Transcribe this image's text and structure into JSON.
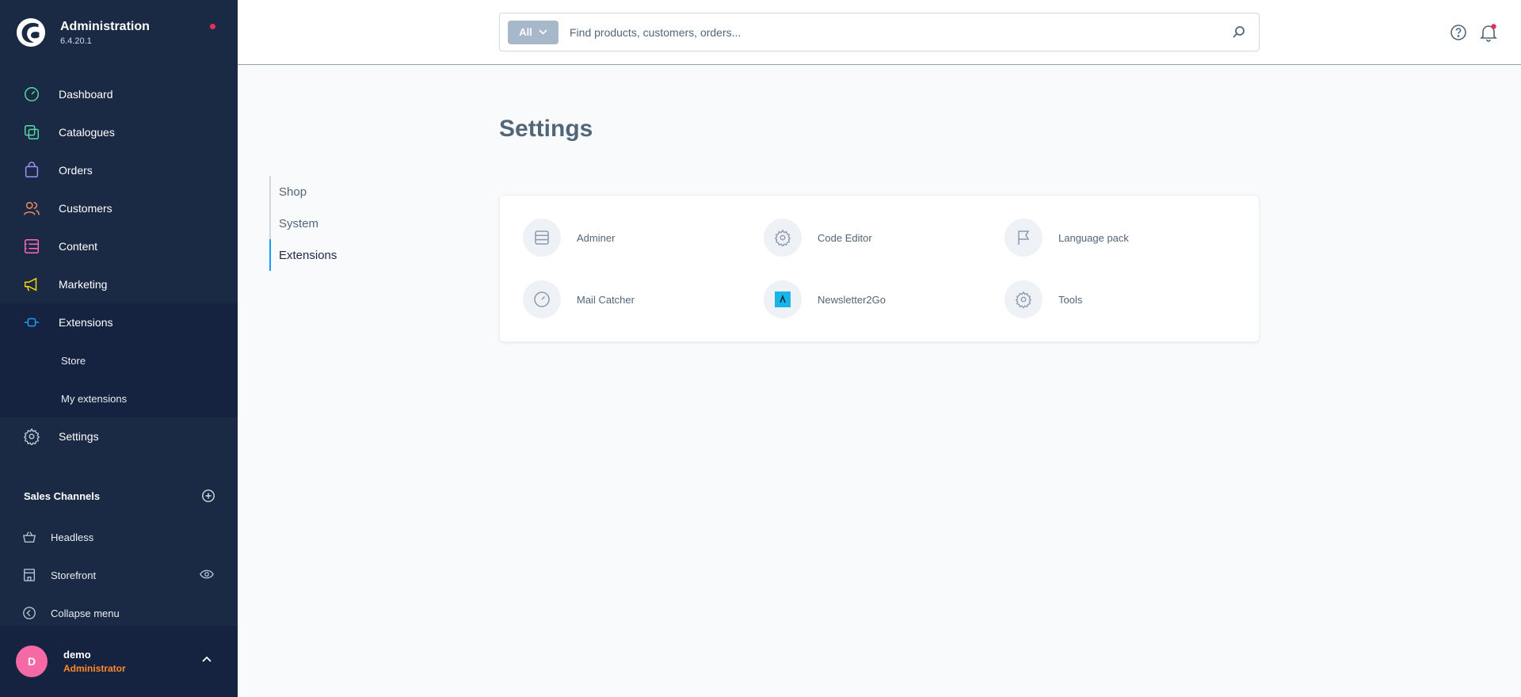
{
  "app": {
    "title": "Administration",
    "version": "6.4.20.1"
  },
  "nav": {
    "items": [
      {
        "label": "Dashboard",
        "icon": "dashboard-icon",
        "color": "#57d9a3"
      },
      {
        "label": "Catalogues",
        "icon": "catalogue-icon",
        "color": "#57d9a3"
      },
      {
        "label": "Orders",
        "icon": "orders-icon",
        "color": "#a092f0"
      },
      {
        "label": "Customers",
        "icon": "customers-icon",
        "color": "#f88962"
      },
      {
        "label": "Content",
        "icon": "content-icon",
        "color": "#ff68b4"
      },
      {
        "label": "Marketing",
        "icon": "marketing-icon",
        "color": "#ffd700"
      },
      {
        "label": "Extensions",
        "icon": "extensions-icon",
        "color": "#189eff"
      }
    ],
    "sub_items": [
      {
        "label": "Store"
      },
      {
        "label": "My extensions"
      }
    ],
    "settings": {
      "label": "Settings",
      "icon": "gear-icon"
    }
  },
  "sales_channels": {
    "title": "Sales Channels",
    "items": [
      {
        "label": "Headless"
      },
      {
        "label": "Storefront"
      }
    ],
    "collapse_label": "Collapse menu"
  },
  "user": {
    "initial": "D",
    "name": "demo",
    "role": "Administrator"
  },
  "search": {
    "type_label": "All",
    "placeholder": "Find products, customers, orders..."
  },
  "page": {
    "title": "Settings"
  },
  "subnav": {
    "items": [
      "Shop",
      "System",
      "Extensions"
    ],
    "active": "Extensions"
  },
  "extensions": [
    {
      "label": "Adminer",
      "icon": "database-icon"
    },
    {
      "label": "Code Editor",
      "icon": "gear-icon"
    },
    {
      "label": "Language pack",
      "icon": "flag-icon"
    },
    {
      "label": "Mail Catcher",
      "icon": "gauge-icon"
    },
    {
      "label": "Newsletter2Go",
      "icon": "newsletter2go-logo-icon"
    },
    {
      "label": "Tools",
      "icon": "gear-icon"
    }
  ],
  "colors": {
    "sidebar_bg": "#1b2a44",
    "accent": "#189eff",
    "avatar": "#f56aa5",
    "role": "#ff8a2b",
    "notification": "#e3305b"
  }
}
